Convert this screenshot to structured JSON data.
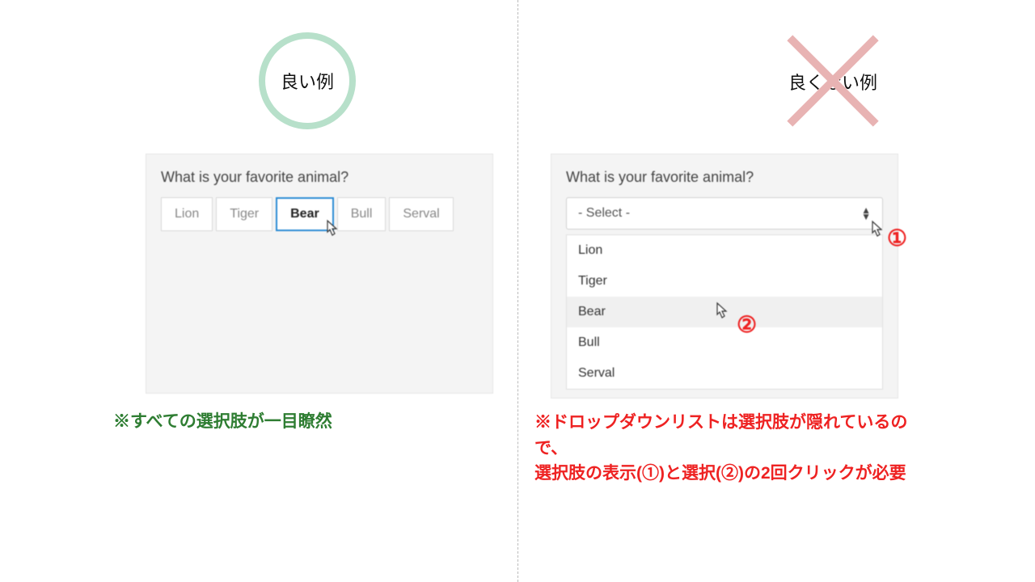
{
  "labels": {
    "good": "良い例",
    "bad": "良くない例"
  },
  "question": "What is your favorite animal?",
  "options": [
    "Lion",
    "Tiger",
    "Bear",
    "Bull",
    "Serval"
  ],
  "selected": "Bear",
  "dropdown_placeholder": "- Select -",
  "markers": {
    "num1": "①",
    "num2": "②"
  },
  "captions": {
    "good": "※すべての選択肢が一目瞭然",
    "bad": "※ドロップダウンリストは選択肢が隠れているので、\n選択肢の表示(①)と選択(②)の2回クリックが必要"
  }
}
